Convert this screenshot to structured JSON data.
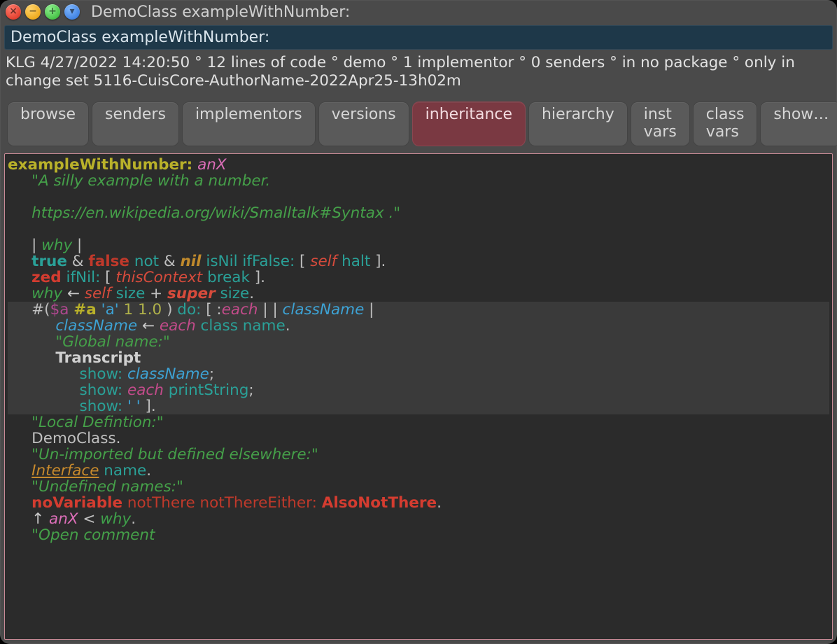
{
  "titlebar": {
    "title": "DemoClass exampleWithNumber:",
    "buttons": {
      "close": "×",
      "min": "−",
      "zoom": "+",
      "menu": "▾"
    }
  },
  "classbar": "DemoClass exampleWithNumber:",
  "meta": "KLG 4/27/2022 14:20:50 ° 12 lines of code ° demo ° 1 implementor ° 0 senders ° in no package ° only in change set 5116-CuisCore-AuthorName-2022Apr25-13h02m",
  "toolbar": {
    "items": [
      {
        "id": "browse",
        "label": "browse",
        "selected": false
      },
      {
        "id": "senders",
        "label": "senders",
        "selected": false
      },
      {
        "id": "implementors",
        "label": "implementors",
        "selected": false
      },
      {
        "id": "versions",
        "label": "versions",
        "selected": false
      },
      {
        "id": "inheritance",
        "label": "inheritance",
        "selected": true
      },
      {
        "id": "hierarchy",
        "label": "hierarchy",
        "selected": false
      },
      {
        "id": "instvars",
        "label": "inst vars",
        "selected": false
      },
      {
        "id": "classvars",
        "label": "class vars",
        "selected": false
      },
      {
        "id": "show",
        "label": "show…",
        "selected": false
      }
    ]
  },
  "code": {
    "selector": "exampleWithNumber:",
    "arg": "anX",
    "comment1": "\"A silly example with a number.",
    "comment2": "https://en.wikipedia.org/wiki/Smalltalk#Syntax .\"",
    "tmp_open": "|",
    "tmp_why": " why ",
    "tmp_close": "|",
    "l4": {
      "true": "true",
      "amp1": " & ",
      "false": "false",
      "not": " not",
      "amp2": " & ",
      "nil": "nil",
      "isNil": " isNil",
      "ifFalse": " ifFalse:",
      "open": " [ ",
      "self": "self",
      "halt": " halt",
      "close": " ]."
    },
    "l5": {
      "zed": "zed",
      "ifNil": " ifNil:",
      "open": " [ ",
      "thisCtx": "thisContext",
      "break": " break",
      "close": " ]."
    },
    "l6": {
      "why": "why",
      "assign": " ← ",
      "self": "self",
      "size1": " size",
      "plus": " + ",
      "super": "super",
      "size2": " size",
      "dot": "."
    },
    "l7": {
      "hash": "#(",
      "char": "$a",
      "sp1": " ",
      "sym": "#a",
      "sp2": " ",
      "str": "'a'",
      "sp3": " ",
      "n1": "1",
      "sp4": " ",
      "n2": "1.0",
      "close": " )",
      "do": " do:",
      "open": " [ :",
      "each": "each",
      "bars": " | | ",
      "cls": "className",
      "bar2": " |"
    },
    "l8": {
      "cls": "className",
      "assign": " ← ",
      "each": "each",
      "classmsg": " class",
      "namemsg": " name",
      "dot": "."
    },
    "l9": "\"Global name:\"",
    "l10": "Transcript",
    "l11": {
      "show": "show:",
      "sp": " ",
      "cls": "className",
      "semi": ";"
    },
    "l12": {
      "show": "show:",
      "sp": " ",
      "each": "each",
      "ps": " printString",
      "semi": ";"
    },
    "l13": {
      "show": "show:",
      "sp": " ",
      "str": "' '",
      "close": " ]."
    },
    "l14": "\"Local Defintion:\"",
    "l15": {
      "dc": "DemoClass",
      "dot": "."
    },
    "l16": "\"Un-imported but defined elsewhere:\"",
    "l17": {
      "iface": "Interface",
      "name": " name",
      "dot": "."
    },
    "l18": "\"Undefined names:\"",
    "l19": {
      "nv": "noVariable",
      "nt": " notThere",
      "nte": " notThereEither:",
      "sp": " ",
      "ant": "AlsoNotThere",
      "dot": "."
    },
    "l20": {
      "ret": "↑ ",
      "anX": "anX",
      "lt": " < ",
      "why": "why",
      "dot": "."
    },
    "l21": "\"Open comment"
  }
}
